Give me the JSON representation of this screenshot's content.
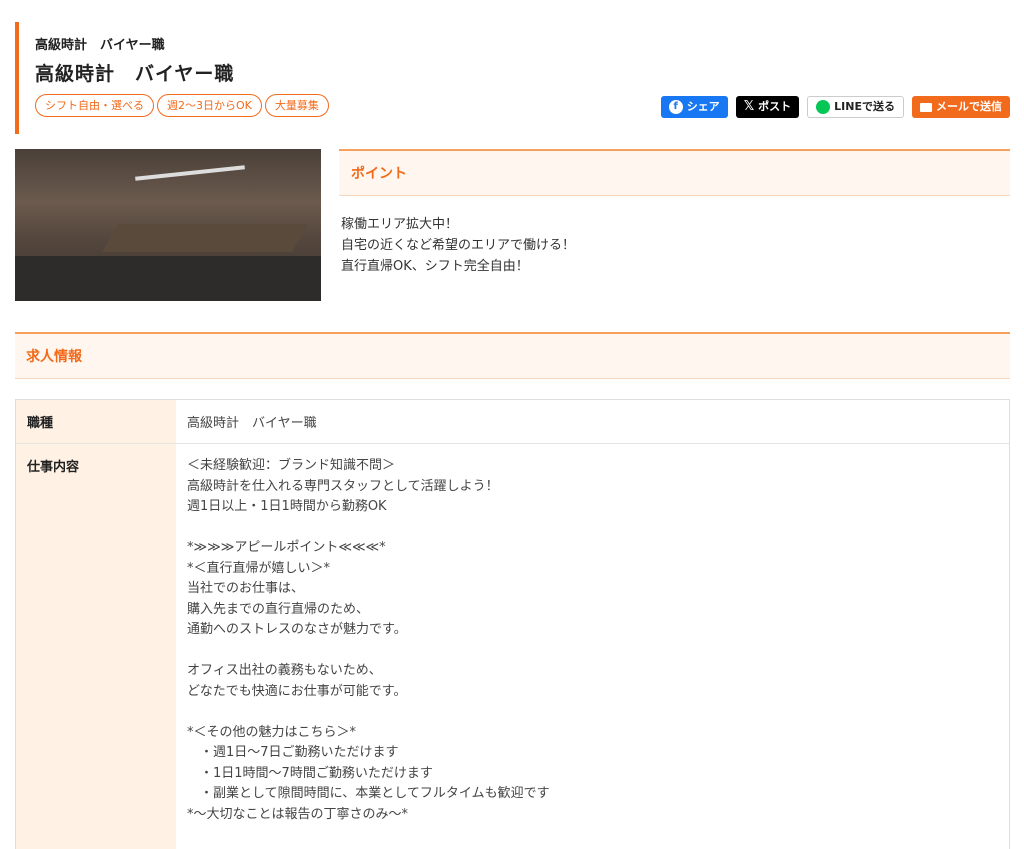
{
  "header": {
    "subtitle": "高級時計　バイヤー職",
    "title": "高級時計　バイヤー職",
    "tags": [
      "シフト自由・選べる",
      "週2～3日からOK",
      "大量募集"
    ]
  },
  "share": {
    "facebook": "シェア",
    "x": "ポスト",
    "line": "LINEで送る",
    "mail": "メールで送信"
  },
  "point": {
    "title": "ポイント",
    "lines": [
      "稼働エリア拡大中！",
      "自宅の近くなど希望のエリアで働ける！",
      "直行直帰OK、シフト完全自由！"
    ]
  },
  "info": {
    "title": "求人情報",
    "rows": [
      {
        "label": "職種",
        "value": "高級時計　バイヤー職"
      },
      {
        "label": "仕事内容"
      }
    ],
    "description": [
      "＜未経験歓迎：ブランド知識不問＞",
      "高級時計を仕入れる専門スタッフとして活躍しよう！",
      "週1日以上・1日1時間から勤務OK",
      "",
      "*≫≫≫アピールポイント≪≪≪*",
      "*＜直行直帰が嬉しい＞*",
      "当社でのお仕事は、",
      "購入先までの直行直帰のため、",
      "通勤へのストレスのなさが魅力です。",
      "",
      "オフィス出社の義務もないため、",
      "どなたでも快適にお仕事が可能です。",
      "",
      "*＜その他の魅力はこちら＞*",
      "　・週1日～7日ご勤務いただけます",
      "　・1日1時間～7時間ご勤務いただけます",
      "　・副業として隙間時間に、本業としてフルタイムも歓迎です",
      "*～大切なことは報告の丁寧さのみ～*"
    ]
  }
}
